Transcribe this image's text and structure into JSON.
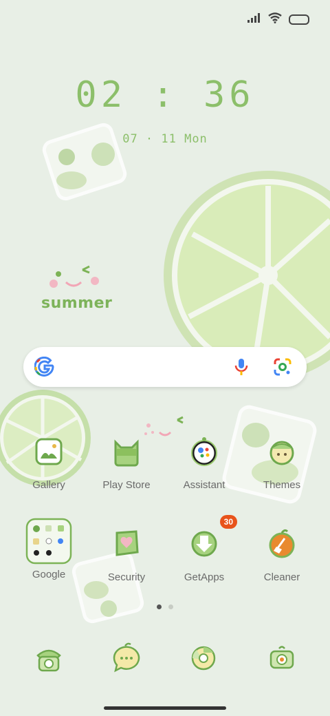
{
  "clock": {
    "time": "02 : 36",
    "date": "07 · 11  Mon"
  },
  "wallpaper": {
    "text": "summer"
  },
  "search": {
    "logo": "G"
  },
  "apps": [
    {
      "label": "Gallery"
    },
    {
      "label": "Play Store"
    },
    {
      "label": "Assistant"
    },
    {
      "label": "Themes"
    },
    {
      "label": "Google"
    },
    {
      "label": "Security"
    },
    {
      "label": "GetApps",
      "badge": "30"
    },
    {
      "label": "Cleaner"
    }
  ],
  "dock": [
    "phone-icon",
    "messages-icon",
    "browser-icon",
    "camera-icon"
  ],
  "colors": {
    "accent": "#8cbf6a",
    "background": "#e8efe6",
    "badge": "#e8531b"
  }
}
